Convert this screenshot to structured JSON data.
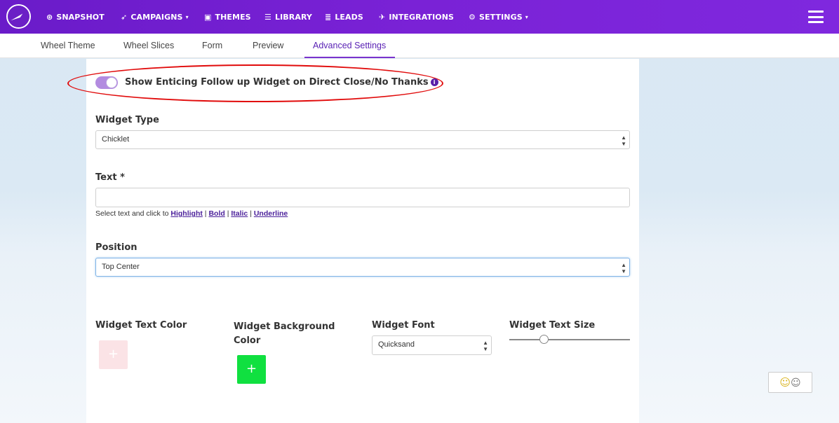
{
  "nav": {
    "items": [
      {
        "label": "SNAPSHOT",
        "icon": "dashboard-icon",
        "glyph": "⊛"
      },
      {
        "label": "CAMPAIGNS",
        "icon": "paper-plane-icon",
        "glyph": "➶",
        "caret": "▾"
      },
      {
        "label": "THEMES",
        "icon": "image-icon",
        "glyph": "▣"
      },
      {
        "label": "LIBRARY",
        "icon": "list-alt-icon",
        "glyph": "☰"
      },
      {
        "label": "LEADS",
        "icon": "list-icon",
        "glyph": "≣"
      },
      {
        "label": "INTEGRATIONS",
        "icon": "plug-icon",
        "glyph": "✈"
      },
      {
        "label": "SETTINGS",
        "icon": "cogs-icon",
        "glyph": "⚙",
        "caret": "▾"
      }
    ]
  },
  "tabs": [
    "Wheel Theme",
    "Wheel Slices",
    "Form",
    "Preview",
    "Advanced Settings"
  ],
  "active_tab": "Advanced Settings",
  "followup": {
    "toggle_label": "Show Enticing Follow up Widget on Direct Close/No Thanks",
    "toggle_on": true,
    "info_glyph": "i"
  },
  "widget_type": {
    "label": "Widget Type",
    "value": "Chicklet"
  },
  "text_field": {
    "label": "Text *",
    "value": ""
  },
  "helper": {
    "prefix": "Select text and click to ",
    "highlight": "Highlight",
    "bold": "Bold",
    "italic": "Italic",
    "underline": "Underline",
    "sep": " | "
  },
  "position": {
    "label": "Position",
    "value": "Top Center"
  },
  "widget_text_color": {
    "label": "Widget Text Color",
    "color": "#fbe3e6",
    "plus": "+"
  },
  "widget_bg_color": {
    "label": "Widget Background Color",
    "color": "#10e040",
    "plus": "+"
  },
  "widget_font": {
    "label": "Widget Font",
    "value": "Quicksand"
  },
  "widget_text_size": {
    "label": "Widget Text Size",
    "level": 0.27
  },
  "select_arrows": "▲▼",
  "colors": {
    "nav_bg": "#7322d2",
    "accent": "#5a22b5",
    "annotation": "#e10b0b"
  }
}
